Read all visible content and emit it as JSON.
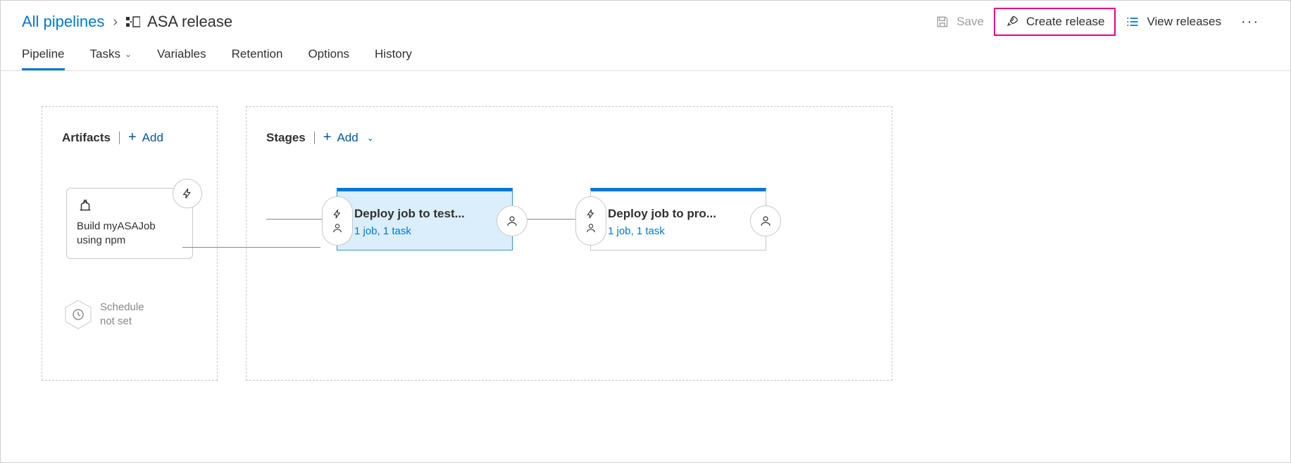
{
  "breadcrumb": {
    "parent": "All pipelines",
    "current": "ASA release"
  },
  "toolbar": {
    "save_label": "Save",
    "create_release_label": "Create release",
    "view_releases_label": "View releases"
  },
  "tabs": [
    {
      "label": "Pipeline",
      "active": true
    },
    {
      "label": "Tasks",
      "has_dropdown": true
    },
    {
      "label": "Variables"
    },
    {
      "label": "Retention"
    },
    {
      "label": "Options"
    },
    {
      "label": "History"
    }
  ],
  "panels": {
    "artifacts": {
      "title": "Artifacts",
      "add_label": "Add"
    },
    "stages": {
      "title": "Stages",
      "add_label": "Add"
    }
  },
  "artifact": {
    "name": "Build myASAJob using npm"
  },
  "schedule": {
    "line1": "Schedule",
    "line2": "not set"
  },
  "stages": [
    {
      "title": "Deploy job to test...",
      "subtitle": "1 job, 1 task",
      "selected": true
    },
    {
      "title": "Deploy job to pro...",
      "subtitle": "1 job, 1 task",
      "selected": false
    }
  ],
  "colors": {
    "accent": "#0078d4",
    "highlight_border": "#e3008c"
  }
}
